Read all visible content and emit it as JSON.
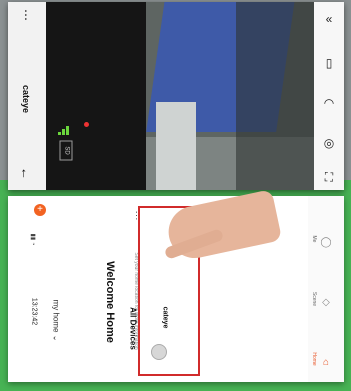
{
  "live_view": {
    "title": "cateye",
    "back_icon": "back-arrow-icon",
    "more_icon": "more-icon",
    "sd_badge": "SD",
    "signal_icon": "signal-icon",
    "controls": [
      "collapse-icon",
      "record-icon",
      "intercom-icon",
      "screenshot-icon",
      "fullscreen-icon"
    ]
  },
  "home": {
    "status_time": "13:23:42",
    "home_selector": "my home ⌄",
    "welcome_title": "Welcome Home",
    "welcome_subtitle": "Set your home location for more information",
    "section_title": "All Devices",
    "device": {
      "name": "cateye",
      "icon": "camera-device-icon"
    },
    "add_icon": "add-icon",
    "tabs": [
      {
        "label": "Home",
        "icon": "home-icon",
        "active": true
      },
      {
        "label": "Scene",
        "icon": "scene-icon",
        "active": false
      },
      {
        "label": "Me",
        "icon": "profile-icon",
        "active": false
      }
    ],
    "accent_color": "#f26322",
    "highlight_color": "#d12b2b"
  }
}
